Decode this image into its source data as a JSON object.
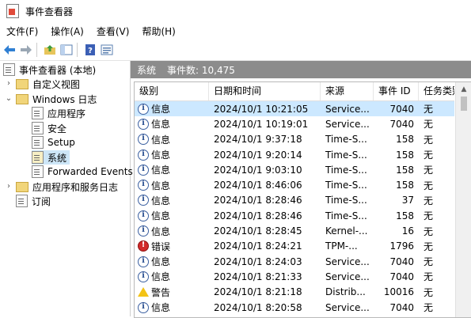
{
  "window": {
    "title": "事件查看器"
  },
  "menu": [
    "文件(F)",
    "操作(A)",
    "查看(V)",
    "帮助(H)"
  ],
  "toolbar": {
    "icons": [
      "back-arrow-icon",
      "forward-arrow-icon",
      "folder-up-icon",
      "console-tree-icon",
      "help-icon",
      "properties-icon"
    ]
  },
  "tree": {
    "root": "事件查看器 (本地)",
    "items": [
      {
        "label": "自定义视图",
        "level": 1,
        "expander": "closed"
      },
      {
        "label": "Windows 日志",
        "level": 1,
        "expander": "open"
      },
      {
        "label": "应用程序",
        "level": 2
      },
      {
        "label": "安全",
        "level": 2
      },
      {
        "label": "Setup",
        "level": 2
      },
      {
        "label": "系统",
        "level": 2,
        "selected": true
      },
      {
        "label": "Forwarded Events",
        "level": 2
      },
      {
        "label": "应用程序和服务日志",
        "level": 1,
        "expander": "closed"
      },
      {
        "label": "订阅",
        "level": 1
      }
    ]
  },
  "pane": {
    "log_name": "系统",
    "count_label": "事件数: 10,475"
  },
  "columns": {
    "level": "级别",
    "date": "日期和时间",
    "source": "来源",
    "event_id": "事件 ID",
    "task": "任务类别"
  },
  "events": [
    {
      "level": "信息",
      "type": "info",
      "date": "2024/10/1 10:21:05",
      "source": "Service...",
      "event_id": "7040",
      "task": "无"
    },
    {
      "level": "信息",
      "type": "info",
      "date": "2024/10/1 10:19:01",
      "source": "Service...",
      "event_id": "7040",
      "task": "无"
    },
    {
      "level": "信息",
      "type": "info",
      "date": "2024/10/1 9:37:18",
      "source": "Time-S...",
      "event_id": "158",
      "task": "无"
    },
    {
      "level": "信息",
      "type": "info",
      "date": "2024/10/1 9:20:14",
      "source": "Time-S...",
      "event_id": "158",
      "task": "无"
    },
    {
      "level": "信息",
      "type": "info",
      "date": "2024/10/1 9:03:10",
      "source": "Time-S...",
      "event_id": "158",
      "task": "无"
    },
    {
      "level": "信息",
      "type": "info",
      "date": "2024/10/1 8:46:06",
      "source": "Time-S...",
      "event_id": "158",
      "task": "无"
    },
    {
      "level": "信息",
      "type": "info",
      "date": "2024/10/1 8:28:46",
      "source": "Time-S...",
      "event_id": "37",
      "task": "无"
    },
    {
      "level": "信息",
      "type": "info",
      "date": "2024/10/1 8:28:46",
      "source": "Time-S...",
      "event_id": "158",
      "task": "无"
    },
    {
      "level": "信息",
      "type": "info",
      "date": "2024/10/1 8:28:45",
      "source": "Kernel-...",
      "event_id": "16",
      "task": "无"
    },
    {
      "level": "错误",
      "type": "error",
      "date": "2024/10/1 8:24:21",
      "source": "TPM-...",
      "event_id": "1796",
      "task": "无"
    },
    {
      "level": "信息",
      "type": "info",
      "date": "2024/10/1 8:24:03",
      "source": "Service...",
      "event_id": "7040",
      "task": "无"
    },
    {
      "level": "信息",
      "type": "info",
      "date": "2024/10/1 8:21:33",
      "source": "Service...",
      "event_id": "7040",
      "task": "无"
    },
    {
      "level": "警告",
      "type": "warn",
      "date": "2024/10/1 8:21:18",
      "source": "Distrib...",
      "event_id": "10016",
      "task": "无"
    },
    {
      "level": "信息",
      "type": "info",
      "date": "2024/10/1 8:20:58",
      "source": "Service...",
      "event_id": "7040",
      "task": "无"
    }
  ]
}
